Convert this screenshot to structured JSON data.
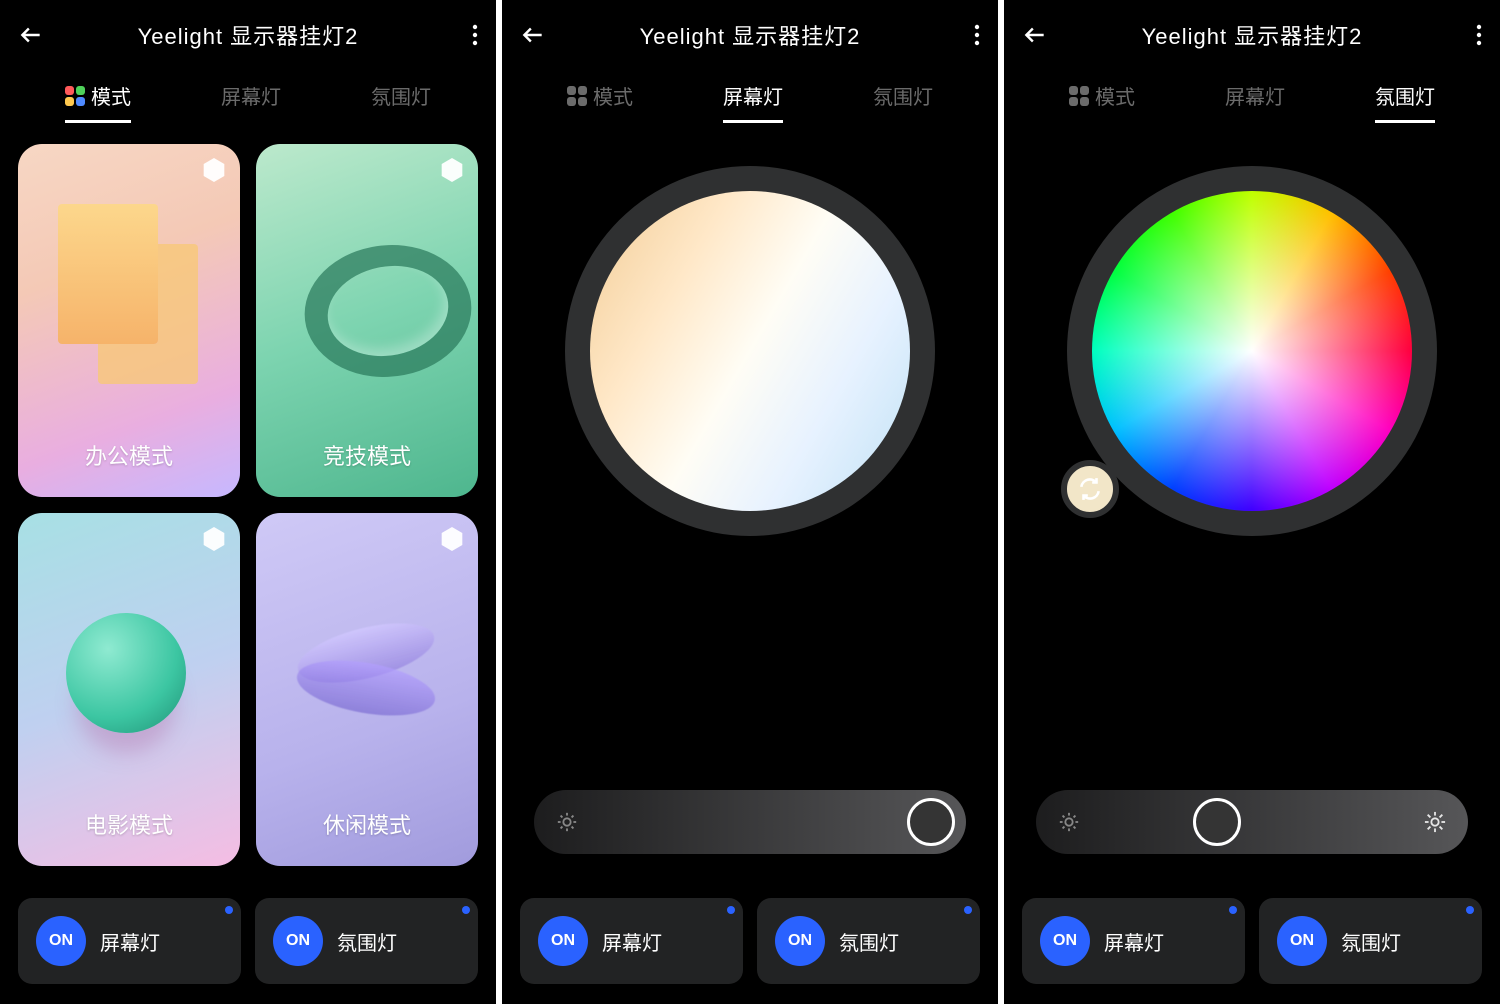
{
  "header": {
    "title": "Yeelight 显示器挂灯2"
  },
  "tabs": {
    "mode": "模式",
    "screen_light": "屏幕灯",
    "ambient_light": "氛围灯"
  },
  "modes": {
    "office": "办公模式",
    "game": "竞技模式",
    "movie": "电影模式",
    "relax": "休闲模式"
  },
  "toggles": {
    "on_label": "ON",
    "screen_light": "屏幕灯",
    "ambient_light": "氛围灯"
  },
  "sliders": {
    "screen_light_percent": 96,
    "ambient_light_percent": 42
  },
  "colors": {
    "accent": "#2a62ff",
    "panel": "#222324",
    "ring": "#2f3031"
  }
}
